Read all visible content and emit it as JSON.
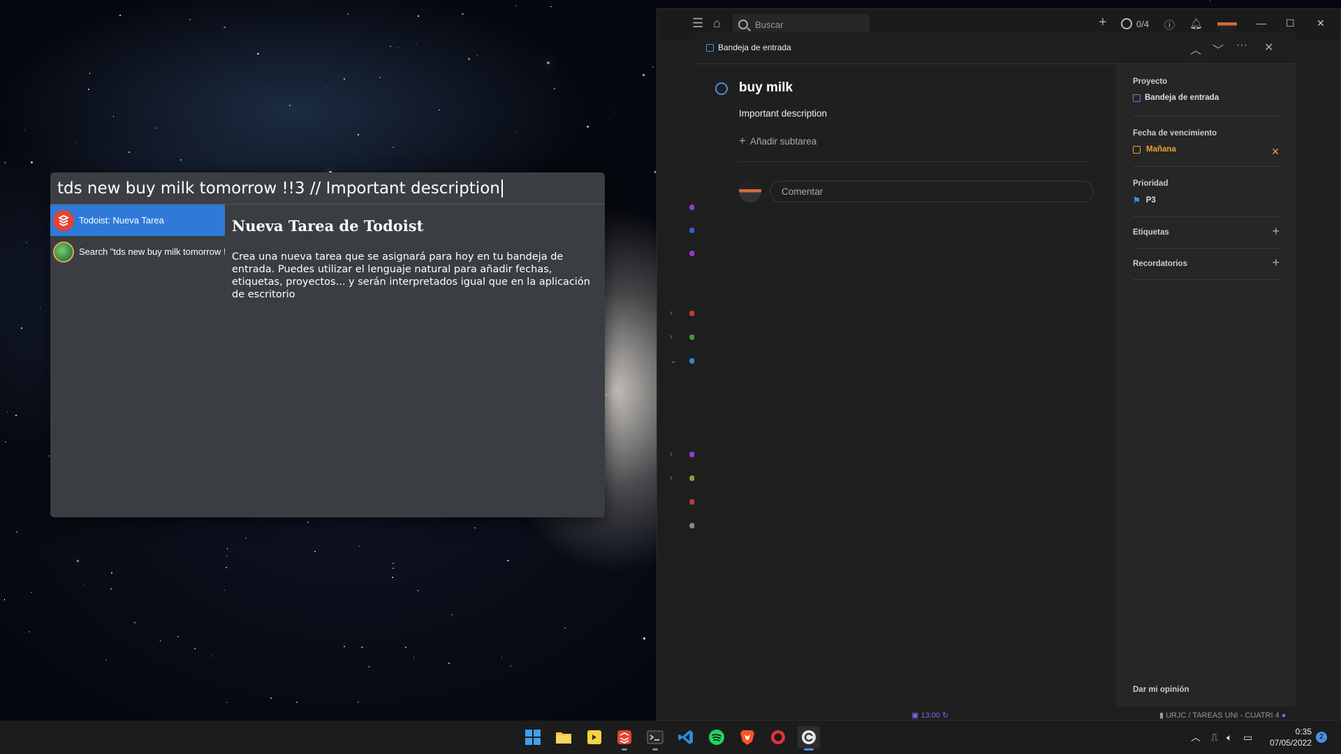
{
  "launcher": {
    "query": "tds new buy milk tomorrow !!3 // Important description",
    "results": [
      {
        "label": "Todoist: Nueva Tarea",
        "icon": "todoist-icon"
      },
      {
        "label": "Search \"tds new buy milk tomorrow !!3 // Important description\"",
        "icon": "globe-icon"
      }
    ],
    "preview": {
      "title": "Nueva Tarea de Todoist",
      "text": "Crea una nueva tarea que se asignará para hoy en tu bandeja de entrada. Puedes utilizar el lenguaje natural para añadir fechas, etiquetas, proyectos... y serán interpretados igual que en la aplicación de escritorio"
    }
  },
  "app": {
    "search_placeholder": "Buscar",
    "karma_counter": "0/4",
    "breadcrumb": "Bandeja de entrada",
    "task": {
      "title": "buy milk",
      "description": "Important description",
      "add_subtask": "Añadir subtarea",
      "comment_placeholder": "Comentar"
    },
    "sidebar": {
      "project_label": "Proyecto",
      "project_value": "Bandeja de entrada",
      "due_label": "Fecha de vencimiento",
      "due_value": "Mañana",
      "priority_label": "Prioridad",
      "priority_value": "P3",
      "labels_label": "Etiquetas",
      "reminders_label": "Recordatorios",
      "feedback": "Dar mi opinión"
    },
    "statusbar": {
      "time": "13:00",
      "project_path": "URJC / TAREAS UNI - CUATRI 4"
    },
    "colors": {
      "accent": "#4a90e2",
      "due": "#f0a030",
      "priority": "#4a90e2",
      "brand": "#e44332"
    }
  },
  "taskbar": {
    "time": "0:35",
    "date": "07/05/2022",
    "notifications": "2"
  }
}
